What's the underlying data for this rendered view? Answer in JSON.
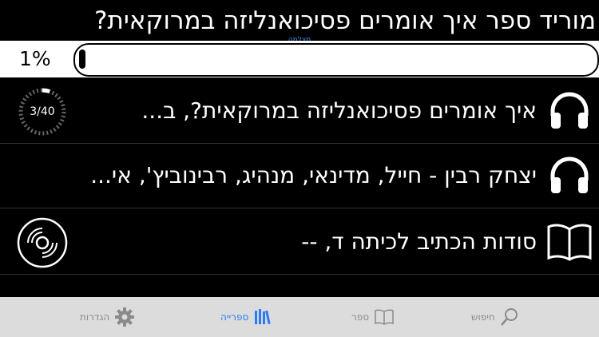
{
  "header": {
    "title": "מוריד ספר איך אומרים פסיכואנליזה במרוקאית?",
    "recorder_label": "מצלמה"
  },
  "download": {
    "percent_text": "1%",
    "progress": 0.01
  },
  "items": [
    {
      "label": "איך אומרים פסיכואנליזה במרוקאית?, ב...",
      "icon": "headphones-icon",
      "counter": "3/40"
    },
    {
      "label": "יצחק רבין - חייל, מדינאי, מנהיג, רבינוביץ', אי...",
      "icon": "headphones-icon"
    },
    {
      "label": "סודות הכתיב לכיתה ד, --",
      "icon": "open-book-icon",
      "left_icon": "disc-icon"
    }
  ],
  "tabbar": {
    "tabs": [
      {
        "label": "הגדרות",
        "icon": "gear-icon"
      },
      {
        "label": "ספרייה",
        "icon": "library-icon",
        "active": true
      },
      {
        "label": "ספר",
        "icon": "book-icon"
      },
      {
        "label": "חיפוש",
        "icon": "search-icon"
      }
    ],
    "active_color": "#2a7bf6"
  }
}
